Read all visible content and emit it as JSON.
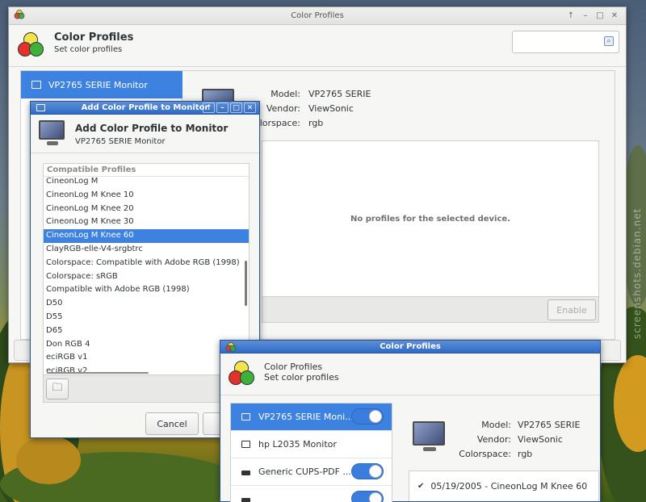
{
  "colors": {
    "accent": "#3b7ddd",
    "selection": "#3d82e0",
    "titlebar_blue": "#2f6bc6",
    "panel_bg": "#f6f6f5"
  },
  "watermark": "screenshots.debian.net",
  "main_window": {
    "title": "Color Profiles",
    "header_title": "Color Profiles",
    "header_subtitle": "Set color profiles",
    "search_placeholder": "",
    "sidebar_selected": "VP2765 SERIE Monitor",
    "device": {
      "model_label": "Model:",
      "model_value": "VP2765 SERIE",
      "vendor_label": "Vendor:",
      "vendor_value": "ViewSonic",
      "colorspace_label": "Colorspace:",
      "colorspace_value": "rgb"
    },
    "empty_message": "No profiles for the selected device.",
    "enable_button": "Enable"
  },
  "add_dialog": {
    "title": "Add Color Profile to Monitor",
    "header_title": "Add Color Profile to Monitor",
    "header_subtitle": "VP2765 SERIE Monitor",
    "list_header": "Compatible Profiles",
    "selected_index": 4,
    "profiles": [
      "CineonLog M",
      "CineonLog M Knee 10",
      "CineonLog M Knee 20",
      "CineonLog M Knee 30",
      "CineonLog M Knee 60",
      "ClayRGB-elle-V4-srgbtrc",
      "Colorspace: Compatible with Adobe RGB (1998)",
      "Colorspace: sRGB",
      "Compatible with Adobe RGB (1998)",
      "D50",
      "D55",
      "D65",
      "Don RGB 4",
      "eciRGB v1",
      "eciRGB v2"
    ],
    "cancel_button": "Cancel"
  },
  "second_window": {
    "title": "Color Profiles",
    "header_title": "Color Profiles",
    "header_subtitle": "Set color profiles",
    "devices": [
      {
        "label": "VP2765 SERIE Moni...",
        "icon": "monitor-icon",
        "toggle": true,
        "selected": true
      },
      {
        "label": "hp L2035 Monitor",
        "icon": "monitor-icon",
        "toggle": false,
        "selected": false
      },
      {
        "label": "Generic CUPS-PDF ...",
        "icon": "printer-icon",
        "toggle": true,
        "selected": false
      },
      {
        "label": "",
        "icon": "printer-icon",
        "toggle": true,
        "selected": false
      }
    ],
    "device": {
      "model_label": "Model:",
      "model_value": "VP2765 SERIE",
      "vendor_label": "Vendor:",
      "vendor_value": "ViewSonic",
      "colorspace_label": "Colorspace:",
      "colorspace_value": "rgb"
    },
    "profile_entry": "05/19/2005 - CineonLog M Knee 60"
  }
}
